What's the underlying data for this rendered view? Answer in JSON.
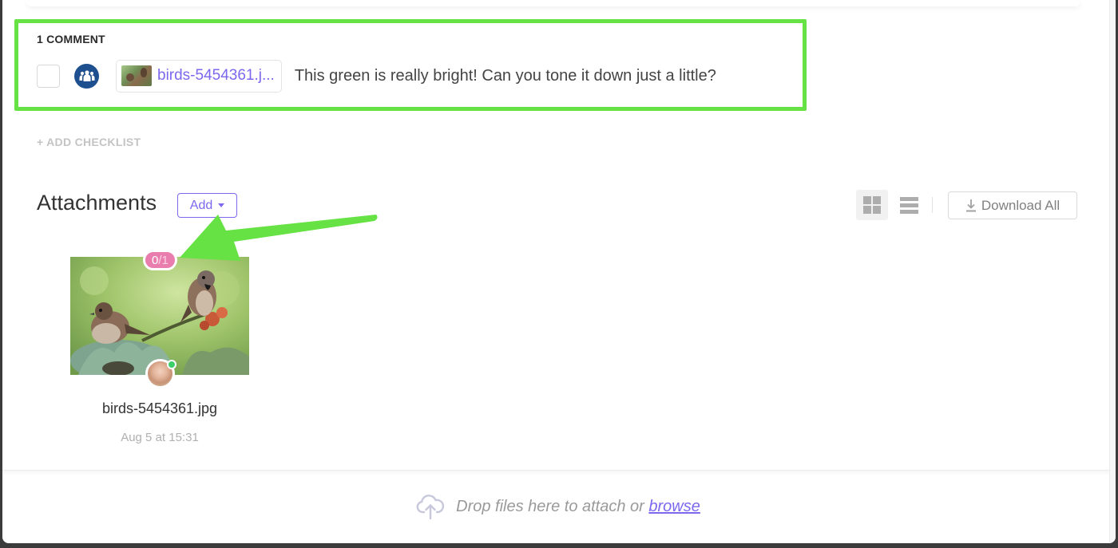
{
  "comments": {
    "count_label": "1 COMMENT",
    "items": [
      {
        "resolved": false,
        "assignee_icon": "team-icon",
        "attachment_name": "birds-5454361.j...",
        "text": "This green is really bright! Can you tone it down just a little?"
      }
    ]
  },
  "checklist": {
    "add_label": "+ ADD CHECKLIST"
  },
  "attachments": {
    "title": "Attachments",
    "add_button_label": "Add",
    "view_modes": [
      "grid",
      "list"
    ],
    "active_view": "grid",
    "download_all_label": "Download All",
    "files": [
      {
        "name": "birds-5454361.jpg",
        "date": "Aug 5 at 15:31",
        "review_done": "0",
        "review_total": "/1",
        "uploader_online": true
      }
    ]
  },
  "dropzone": {
    "text": "Drop files here to attach or ",
    "link_label": "browse"
  },
  "colors": {
    "accent": "#7b68ee",
    "highlight": "#66e244",
    "review_badge": "#e97eae",
    "online": "#3ccf6a",
    "assignee": "#1e4f8f"
  }
}
